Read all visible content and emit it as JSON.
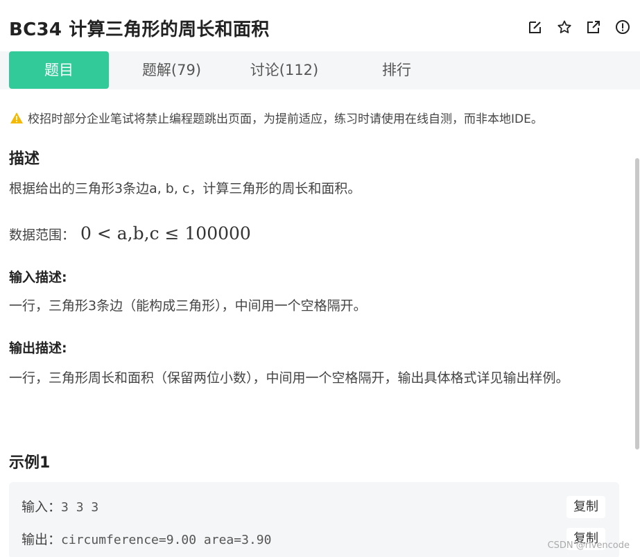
{
  "header": {
    "problem_code": "BC34",
    "problem_title": "计算三角形的周长和面积",
    "icons": [
      "edit-icon",
      "star-icon",
      "share-icon",
      "info-icon"
    ]
  },
  "tabs": [
    {
      "label": "题目",
      "active": true
    },
    {
      "label": "题解(79)",
      "active": false
    },
    {
      "label": "讨论(112)",
      "active": false
    },
    {
      "label": "排行",
      "active": false
    }
  ],
  "notice": {
    "icon": "warning-icon",
    "text": "校招时部分企业笔试将禁止编程题跳出页面，为提前适应，练习时请使用在线自测，而非本地IDE。"
  },
  "description": {
    "heading": "描述",
    "text": "根据给出的三角形3条边a, b, c，计算三角形的周长和面积。",
    "range_label": "数据范围：",
    "range_math": "0 < a,b,c ≤ 100000"
  },
  "input_desc": {
    "heading": "输入描述:",
    "text": "一行，三角形3条边（能构成三角形），中间用一个空格隔开。"
  },
  "output_desc": {
    "heading": "输出描述:",
    "text": "一行，三角形周长和面积（保留两位小数），中间用一个空格隔开，输出具体格式详见输出样例。"
  },
  "example": {
    "heading": "示例1",
    "input_label": "输入：",
    "input_value": "3 3 3",
    "output_label": "输出：",
    "output_value": "circumference=9.00 area=3.90",
    "copy_label": "复制"
  },
  "colors": {
    "accent": "#32ca99",
    "tabbar_bg": "#f5f6f8",
    "warning": "#f5b800"
  },
  "watermark": "CSDN @rivencode"
}
